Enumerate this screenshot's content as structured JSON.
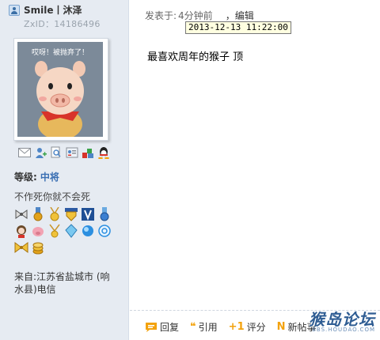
{
  "user": {
    "name": "Smile丨沐泽",
    "zxid": "ZxID：14186496",
    "avatar_caption": "哎呀！被抛弃了！",
    "rank_label": "等级:",
    "rank_value": "中将",
    "signature": "不作死你就不会死",
    "location": "来自:江苏省盐城市 (响水县)电信"
  },
  "contact_icons": [
    "mail-icon",
    "add-friend-icon",
    "search-posts-icon",
    "profile-card-icon",
    "blocks-icon",
    "qq-icon"
  ],
  "medals": [
    "bow-medal",
    "medal-ribbon",
    "medal-flower",
    "medal-shield",
    "medal-crest",
    "medal-blue",
    "medal-girl",
    "medal-pig",
    "medal-chain",
    "medal-gem",
    "medal-orb",
    "medal-swirl",
    "medal-bow2",
    "medal-coins"
  ],
  "post": {
    "posted_label": "发表于:",
    "posted_time": "4分钟前",
    "edit_label": "，编辑",
    "tooltip": "2013-12-13 11:22:00",
    "body": "最喜欢周年的猴子 顶"
  },
  "actions": {
    "reply": "回复",
    "quote": "引用",
    "rate": "评分",
    "new_post": "新帖事"
  },
  "logo": {
    "main": "猴岛论坛",
    "sub": "BBS.HOUDAO.COM"
  },
  "colors": {
    "sidebar_bg": "#e6ebf2",
    "rank_color": "#3a6fb3",
    "action_icon": "#f3a20c"
  }
}
